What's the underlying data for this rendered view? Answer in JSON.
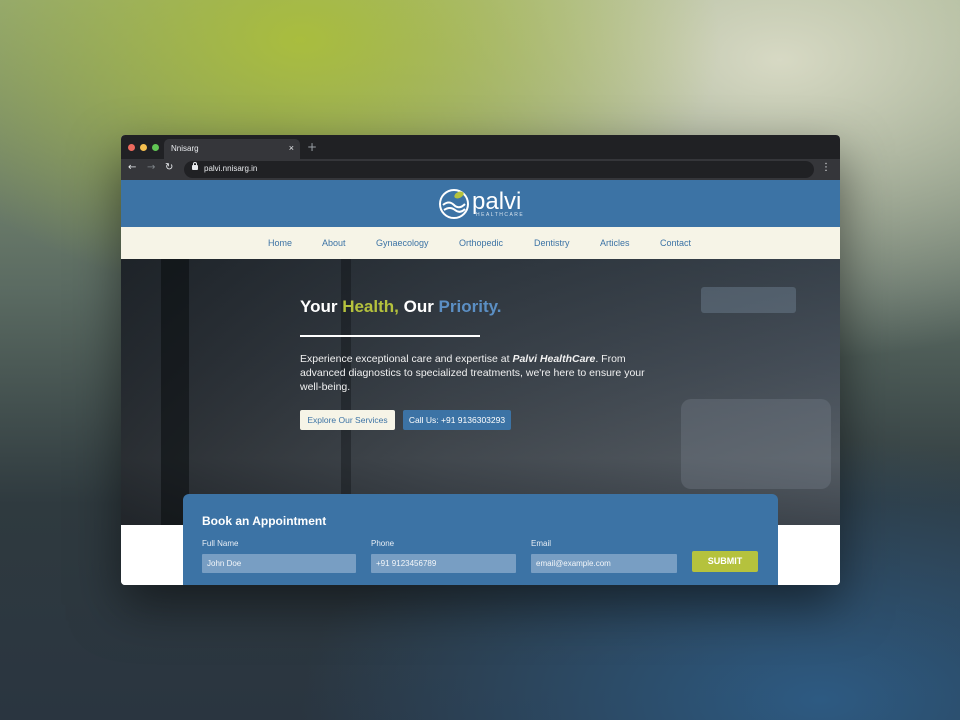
{
  "browser": {
    "tab_title": "Nnisarg",
    "tab_close": "×",
    "new_tab": "+",
    "url": "palvi.nnisarg.in",
    "back_icon": "arrow-left-icon",
    "forward_icon": "arrow-right-icon",
    "reload_icon": "reload-icon",
    "menu_icon": "kebab-menu-icon"
  },
  "site": {
    "logo_text": "palvi",
    "logo_sub": "HEALTHCARE",
    "nav": [
      "Home",
      "About",
      "Gynaecology",
      "Orthopedic",
      "Dentistry",
      "Articles",
      "Contact"
    ]
  },
  "hero": {
    "title_part1": "Your ",
    "title_part2": "Health,",
    "title_part3": " Our ",
    "title_part4": "Priority.",
    "desc_before": "Experience exceptional care and expertise at ",
    "desc_brand": "Palvi HealthCare",
    "desc_after": ". From advanced diagnostics to specialized treatments, we're here to ensure your well-being.",
    "btn_explore": "Explore Our Services",
    "btn_call": "Call Us: +91 9136303293"
  },
  "booking": {
    "title": "Book an Appointment",
    "fields": [
      {
        "label": "Full Name",
        "placeholder": "John Doe"
      },
      {
        "label": "Phone",
        "placeholder": "+91 9123456789"
      },
      {
        "label": "Email",
        "placeholder": "email@example.com"
      }
    ],
    "submit": "SUBMIT"
  },
  "colors": {
    "primary_blue": "#3c73a5",
    "accent_green": "#b5c23d",
    "cream": "#f6f4e7"
  }
}
